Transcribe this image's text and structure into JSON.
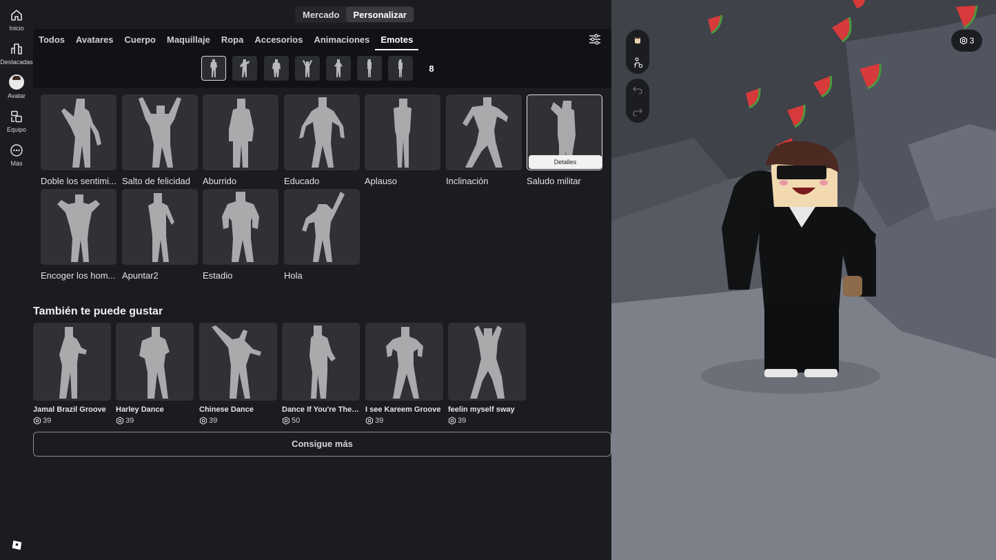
{
  "rail": {
    "items": [
      {
        "label": "Inicio",
        "icon": "home-icon"
      },
      {
        "label": "Destacadas",
        "icon": "charts-icon"
      },
      {
        "label": "Avatar",
        "icon": "avatar-icon"
      },
      {
        "label": "Equipo",
        "icon": "inventory-icon"
      },
      {
        "label": "Más",
        "icon": "more-icon"
      }
    ]
  },
  "top": {
    "market": "Mercado",
    "customize": "Personalizar"
  },
  "tabs": [
    "Todos",
    "Avatares",
    "Cuerpo",
    "Maquillaje",
    "Ropa",
    "Accesorios",
    "Animaciones",
    "Emotes"
  ],
  "active_tab": "Emotes",
  "slots": {
    "count": "8"
  },
  "owned": [
    {
      "name": "Doble los sentimi..."
    },
    {
      "name": "Salto de felicidad"
    },
    {
      "name": "Aburrido"
    },
    {
      "name": "Educado"
    },
    {
      "name": "Aplauso"
    },
    {
      "name": "Inclinación"
    },
    {
      "name": "Saludo militar",
      "details": "Detalles"
    },
    {
      "name": "Encoger los hom..."
    },
    {
      "name": "Apuntar2"
    },
    {
      "name": "Estadio"
    },
    {
      "name": "Hola"
    }
  ],
  "recommended": {
    "title": "También te puede gustar",
    "items": [
      {
        "name": "Jamal Brazil Groove",
        "price": "39"
      },
      {
        "name": "Harley Dance",
        "price": "39"
      },
      {
        "name": "Chinese Dance",
        "price": "39"
      },
      {
        "name": "Dance If You're The ...",
        "price": "50"
      },
      {
        "name": "I see Kareem Groove",
        "price": "39"
      },
      {
        "name": "feelin myself sway",
        "price": "39"
      }
    ],
    "more": "Consigue más"
  },
  "scene": {
    "robux": "3"
  },
  "colors": {
    "panel": "#1b1c20",
    "tabbar": "#111215",
    "card": "#2f3135",
    "accent": "#ffffff"
  }
}
